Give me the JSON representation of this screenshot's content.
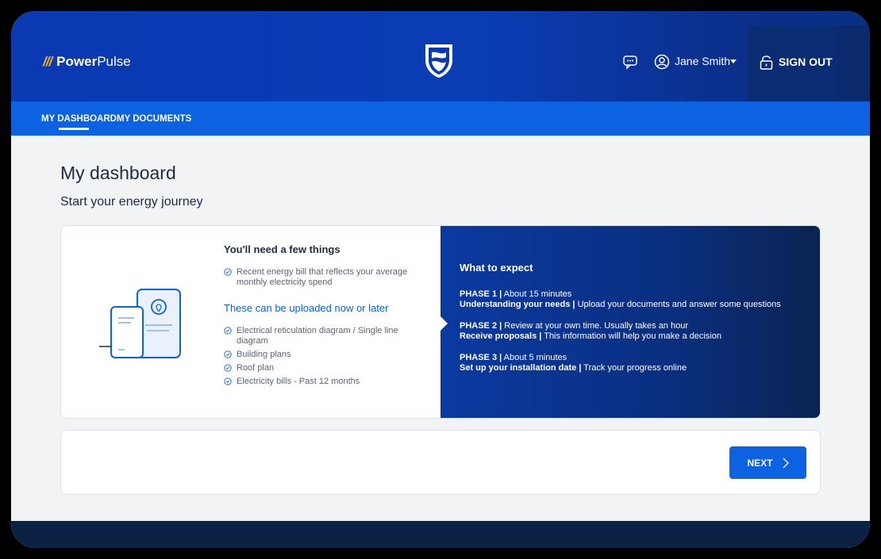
{
  "header": {
    "brand_prefix": "///",
    "brand_bold": "Power",
    "brand_rest": "Pulse",
    "user_name": "Jane Smith",
    "sign_out": "SIGN OUT"
  },
  "nav": {
    "tabs": [
      {
        "label": "MY DASHBOARD",
        "active": true
      },
      {
        "label": "MY DOCUMENTS",
        "active": false
      }
    ]
  },
  "page": {
    "title": "My dashboard",
    "subtitle": "Start your energy journey"
  },
  "needs": {
    "heading": "You'll need a few things",
    "items": [
      "Recent energy bill that reflects your average monthly electricity spend"
    ],
    "upload_heading": "These can be uploaded now or later",
    "upload_items": [
      "Electrical reticulation diagram / Single line diagram",
      "Building plans",
      "Roof plan",
      "Electricity bills - Past 12 months"
    ]
  },
  "expect": {
    "heading": "What to expect",
    "phases": [
      {
        "label": "PHASE 1 |",
        "time": "About 15 minutes",
        "title": "Understanding your needs |",
        "desc": "Upload your documents and answer some questions"
      },
      {
        "label": "PHASE 2 |",
        "time": "Review at your own time. Usually takes an hour",
        "title": "Receive proposals |",
        "desc": "This information will help you make a decision"
      },
      {
        "label": "PHASE 3 |",
        "time": "About 5 minutes",
        "title": "Set up your installation date |",
        "desc": "Track your progress online"
      }
    ]
  },
  "footer": {
    "next_label": "NEXT"
  },
  "colors": {
    "header_blue": "#0a39b2",
    "nav_blue": "#0c62e0",
    "accent_gold": "#f2b51e",
    "dark_navy": "#0b2245"
  },
  "icons": [
    "shield-logo-icon",
    "chat-icon",
    "user-icon",
    "caret-down-icon",
    "lock-icon",
    "check-circle-icon",
    "document-bulb-icon",
    "chevron-right-icon"
  ]
}
